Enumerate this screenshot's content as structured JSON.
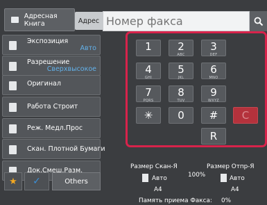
{
  "header": {
    "address_book": "Адресная Книга",
    "address_label": "Адрес",
    "fax_placeholder": "Номер факса"
  },
  "settings": [
    {
      "name": "Экспозиция",
      "value": "Авто"
    },
    {
      "name": "Разрешение",
      "value": "Сверхвысокое"
    },
    {
      "name": "Оригинал",
      "value": ""
    },
    {
      "name": "Работа Строит",
      "value": ""
    },
    {
      "name": "Реж. Медл.Прос",
      "value": ""
    },
    {
      "name": "Скан. Плотной Бумаги",
      "value": ""
    },
    {
      "name": "Док.Смеш.Разм.",
      "value": ""
    }
  ],
  "bottom": {
    "others": "Others"
  },
  "keypad": [
    {
      "digit": "1",
      "sub": ""
    },
    {
      "digit": "2",
      "sub": "ABC"
    },
    {
      "digit": "3",
      "sub": "DEF"
    },
    {
      "digit": "4",
      "sub": "GHI"
    },
    {
      "digit": "5",
      "sub": "JKL"
    },
    {
      "digit": "6",
      "sub": "MNO"
    },
    {
      "digit": "7",
      "sub": "PQRS"
    },
    {
      "digit": "8",
      "sub": "TUV"
    },
    {
      "digit": "9",
      "sub": "WXYZ"
    },
    {
      "digit": "✳",
      "sub": ""
    },
    {
      "digit": "0",
      "sub": ""
    },
    {
      "digit": "#",
      "sub": ""
    },
    {
      "digit": "C",
      "sub": ""
    },
    {
      "digit": "R",
      "sub": ""
    }
  ],
  "info": {
    "scan_size_label": "Размер Скан-Я",
    "send_size_label": "Размер Отпр-Я",
    "scan_mode": "Авто",
    "send_mode": "Авто",
    "ratio": "100%",
    "scan_paper": "A4",
    "send_paper": "A4",
    "memory_label": "Память приема Факса:",
    "memory_value": "0%"
  },
  "colors": {
    "keypad_highlight": "#d8234b",
    "accent_value": "#63b1ea",
    "star": "#f3a821",
    "clear_key": "#b4323c"
  }
}
